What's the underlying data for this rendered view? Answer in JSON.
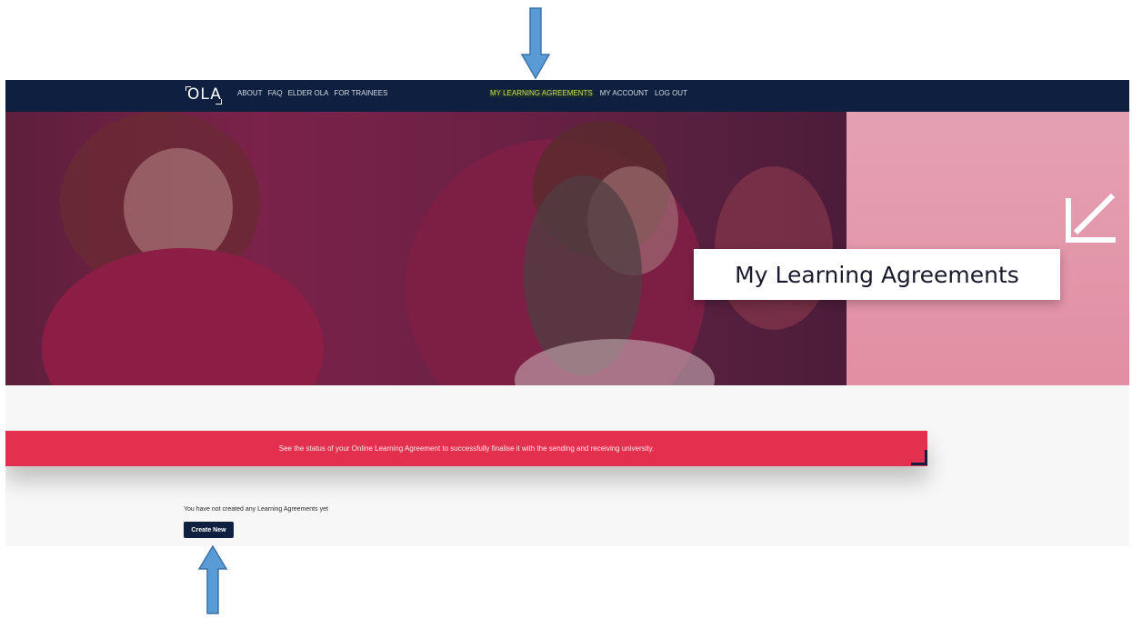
{
  "nav": {
    "logo": "OLA",
    "left_items": [
      "ABOUT",
      "FAQ",
      "ELDER OLA",
      "FOR TRAINEES"
    ],
    "right_items": [
      "MY LEARNING AGREEMENTS",
      "MY ACCOUNT",
      "LOG OUT"
    ],
    "active_item": "MY LEARNING AGREEMENTS"
  },
  "hero": {
    "title": "My Learning Agreements",
    "icon": "arrow-down-left-icon"
  },
  "banner": {
    "text": "See the status of your Online Learning Agreement to successfully finalise it with the sending and receiving university."
  },
  "content": {
    "empty_message": "You have not created any Learning Agreements yet",
    "create_button": "Create New"
  },
  "annotations": {
    "arrow_color": "#5b9bd5",
    "arrows": [
      "down-arrow-annotation",
      "up-arrow-annotation"
    ]
  },
  "colors": {
    "navbar": "#0e1f3f",
    "active_nav": "#c6e05a",
    "banner": "#e4304f",
    "hero_pink": "#e28ea3"
  }
}
